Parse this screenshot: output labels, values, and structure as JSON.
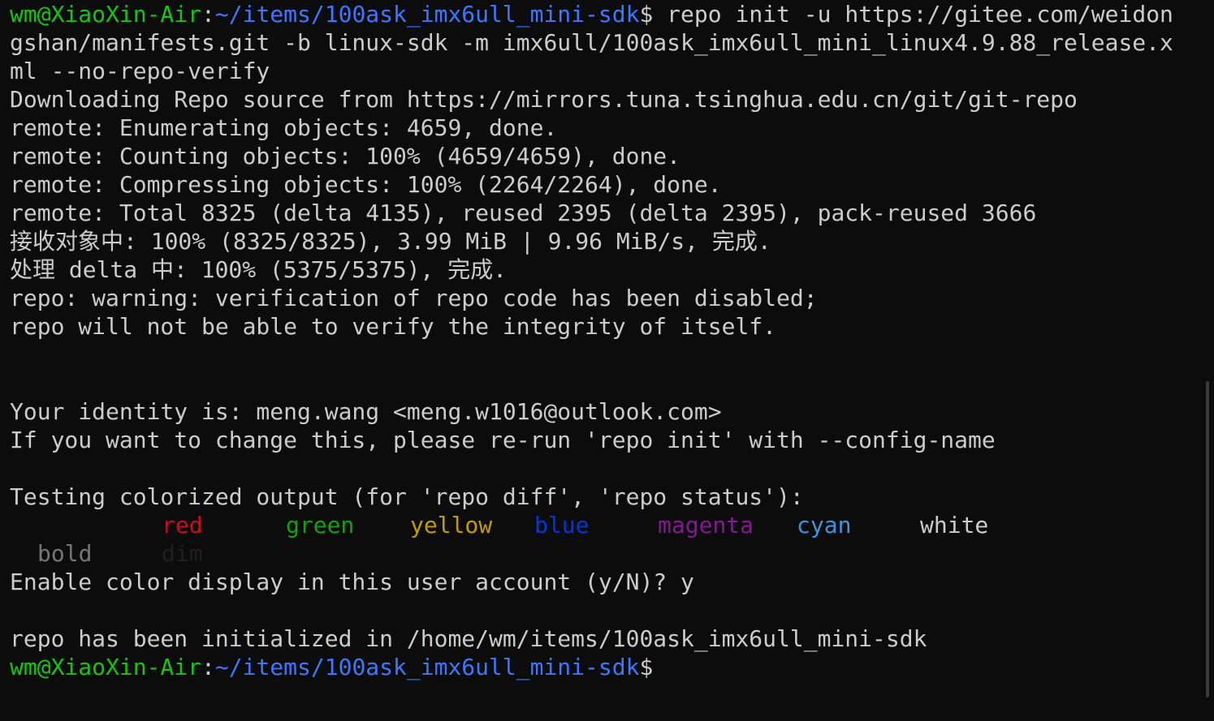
{
  "terminal": {
    "prompt": {
      "user_host": "wm@XiaoXin-Air",
      "colon": ":",
      "path": "~/items/100ask_imx6ull_mini-sdk",
      "dollar": "$"
    },
    "command_line_1": " repo init -u https://gitee.com/weidon",
    "command_line_2": "gshan/manifests.git -b linux-sdk -m imx6ull/100ask_imx6ull_mini_linux4.9.88_release.x",
    "command_line_3": "ml --no-repo-verify",
    "output": [
      "Downloading Repo source from https://mirrors.tuna.tsinghua.edu.cn/git/git-repo",
      "remote: Enumerating objects: 4659, done.",
      "remote: Counting objects: 100% (4659/4659), done.",
      "remote: Compressing objects: 100% (2264/2264), done.",
      "remote: Total 8325 (delta 4135), reused 2395 (delta 2395), pack-reused 3666",
      "接收对象中: 100% (8325/8325), 3.99 MiB | 9.96 MiB/s, 完成.",
      "处理 delta 中: 100% (5375/5375), 完成.",
      "repo: warning: verification of repo code has been disabled;",
      "repo will not be able to verify the integrity of itself.",
      "",
      "",
      "Your identity is: meng.wang <meng.w1016@outlook.com>",
      "If you want to change this, please re-run 'repo init' with --config-name",
      "",
      "Testing colorized output (for 'repo diff', 'repo status'):"
    ],
    "colors": {
      "red": "red",
      "green": "green",
      "yellow": "yellow",
      "blue": "blue",
      "magenta": "magenta",
      "cyan": "cyan",
      "white": "white",
      "bold": "bold",
      "dim": "dim"
    },
    "after_colors": [
      "Enable color display in this user account (y/N)? y",
      "",
      "repo has been initialized in /home/wm/items/100ask_imx6ull_mini-sdk"
    ],
    "theme": {
      "background": "#0c0c0c",
      "foreground": "#cccccc",
      "prompt_user": "#16c60c",
      "prompt_path": "#3b78ff"
    }
  }
}
